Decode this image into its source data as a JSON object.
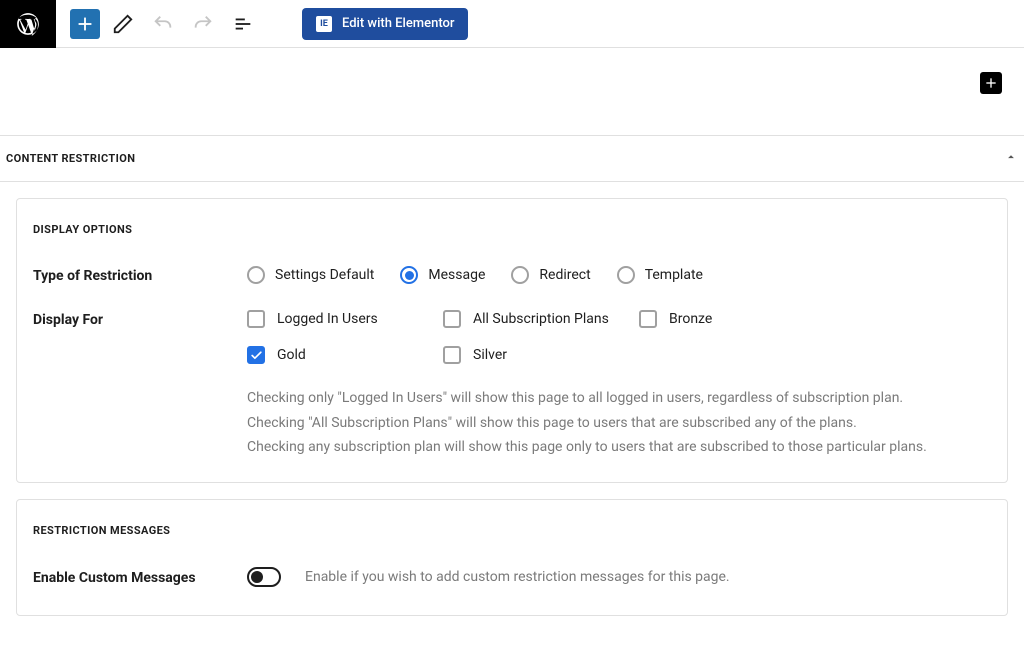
{
  "toolbar": {
    "elementor_label": "Edit with Elementor",
    "elementor_icon_text": "IE"
  },
  "panel": {
    "title": "CONTENT RESTRICTION"
  },
  "display_options": {
    "title": "DISPLAY OPTIONS",
    "type_label": "Type of Restriction",
    "radios": {
      "settings_default": "Settings Default",
      "message": "Message",
      "redirect": "Redirect",
      "template": "Template"
    },
    "display_for_label": "Display For",
    "checkboxes": {
      "logged_in": "Logged In Users",
      "all_plans": "All Subscription Plans",
      "bronze": "Bronze",
      "gold": "Gold",
      "silver": "Silver"
    },
    "help1": "Checking only \"Logged In Users\" will show this page to all logged in users, regardless of subscription plan.",
    "help2": "Checking \"All Subscription Plans\" will show this page to users that are subscribed any of the plans.",
    "help3": "Checking any subscription plan will show this page only to users that are subscribed to those particular plans."
  },
  "restriction_messages": {
    "title": "RESTRICTION MESSAGES",
    "enable_label": "Enable Custom Messages",
    "enable_desc": "Enable if you wish to add custom restriction messages for this page."
  }
}
